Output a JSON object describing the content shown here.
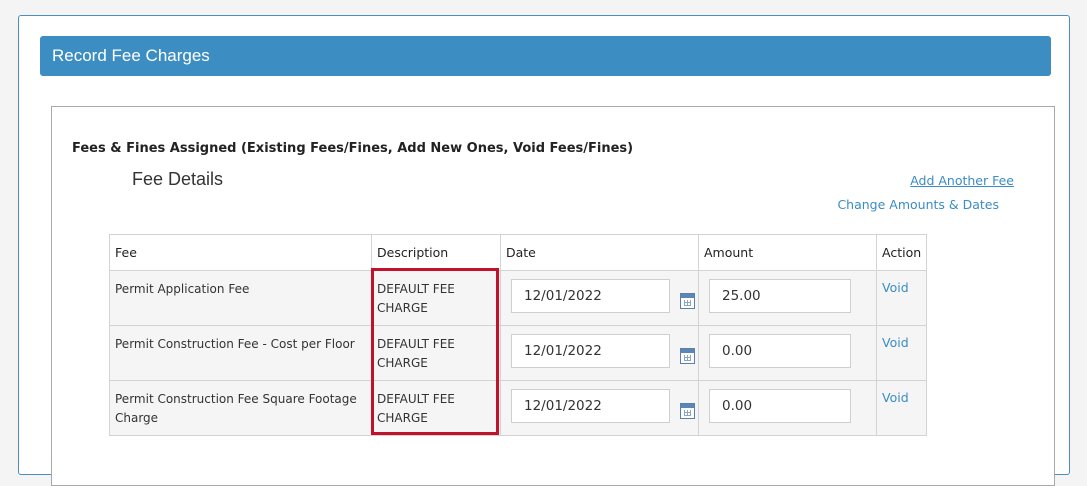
{
  "header": {
    "title": "Record Fee Charges"
  },
  "section": {
    "title": "Fees & Fines Assigned (Existing Fees/Fines, Add New Ones, Void Fees/Fines)",
    "fee_details_title": "Fee Details",
    "add_fee_link": "Add Another Fee",
    "change_link": "Change Amounts & Dates"
  },
  "table": {
    "columns": [
      "Fee",
      "Description",
      "Date",
      "Amount",
      "Action"
    ],
    "rows": [
      {
        "fee": "Permit Application Fee",
        "description": "DEFAULT FEE CHARGE",
        "date": "12/01/2022",
        "amount": "25.00",
        "action": "Void"
      },
      {
        "fee": "Permit Construction Fee - Cost per Floor",
        "description": "DEFAULT FEE CHARGE",
        "date": "12/01/2022",
        "amount": "0.00",
        "action": "Void"
      },
      {
        "fee": "Permit Construction Fee Square Footage Charge",
        "description": "DEFAULT FEE CHARGE",
        "date": "12/01/2022",
        "amount": "0.00",
        "action": "Void"
      }
    ]
  },
  "colors": {
    "header_bg": "#3c8dc1",
    "link": "#3a8cc4",
    "highlight": "#c0132b"
  },
  "icons": {
    "date_picker": "calendar-icon"
  }
}
